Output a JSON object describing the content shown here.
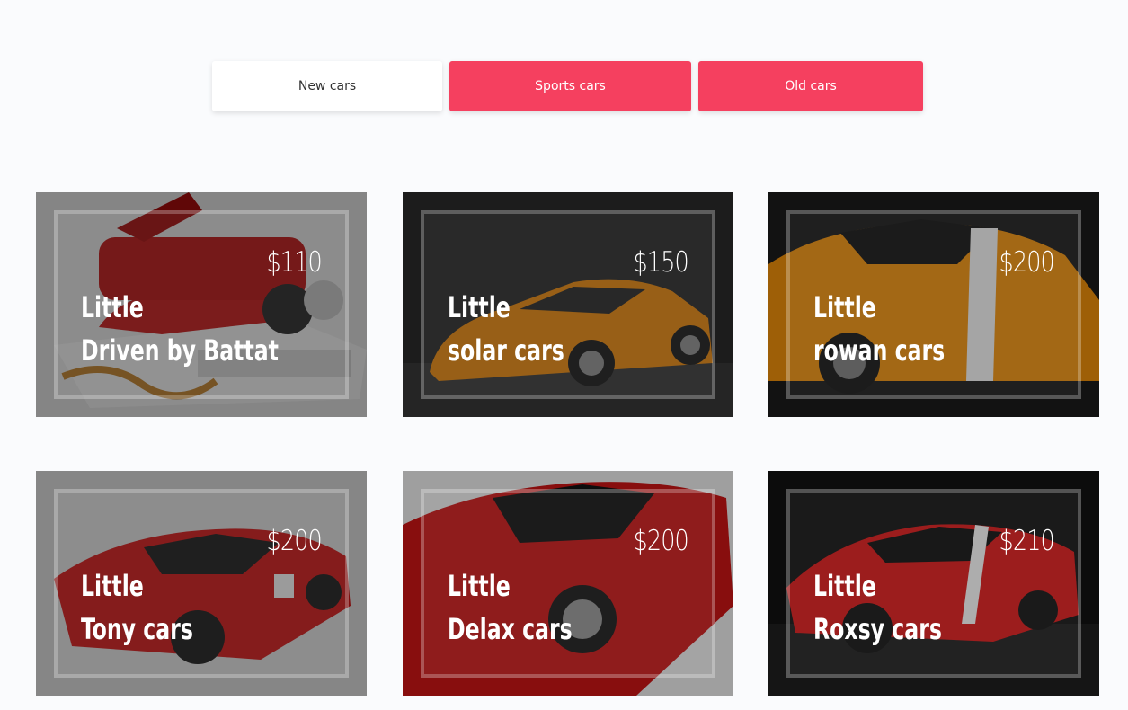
{
  "tabs": [
    {
      "label": "New cars"
    },
    {
      "label": "Sports cars"
    },
    {
      "label": "Old cars"
    }
  ],
  "colors": {
    "accent": "#f5405f",
    "page_background": "#fafbfd"
  },
  "cards": [
    {
      "price": "$110",
      "line1": "Little",
      "line2": "Driven by Battat"
    },
    {
      "price": "$150",
      "line1": "Little",
      "line2": "solar cars"
    },
    {
      "price": "$200",
      "line1": "Little",
      "line2": "rowan cars"
    },
    {
      "price": "$200",
      "line1": "Little",
      "line2": "Tony cars"
    },
    {
      "price": "$200",
      "line1": "Little",
      "line2": "Delax cars"
    },
    {
      "price": "$210",
      "line1": "Little",
      "line2": "Roxsy cars"
    }
  ]
}
